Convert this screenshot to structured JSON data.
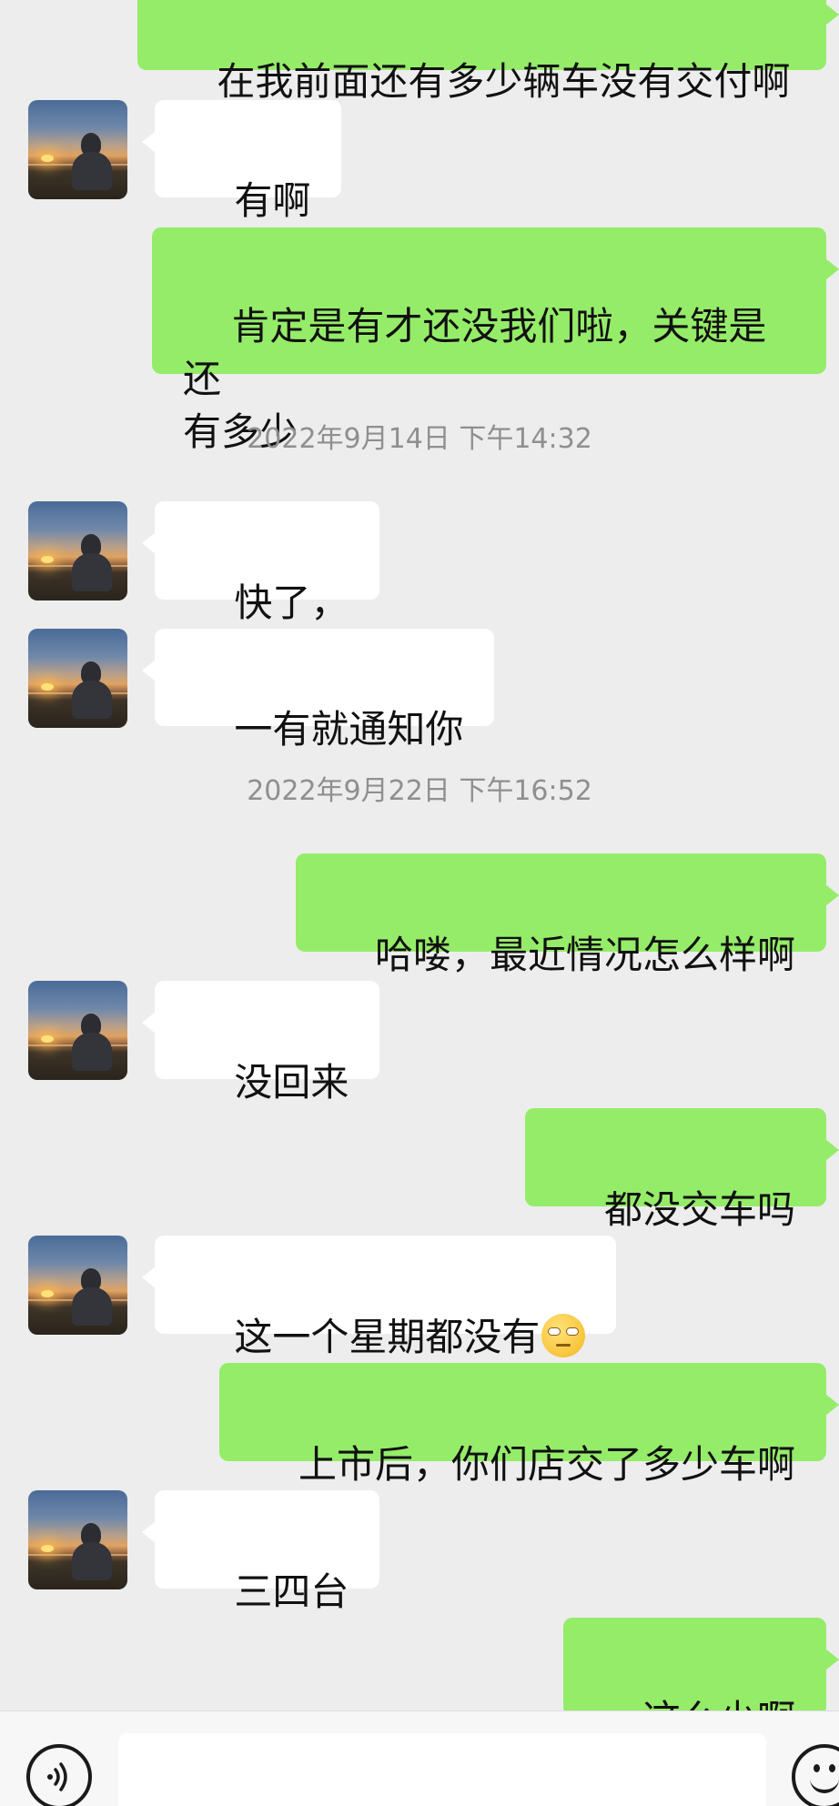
{
  "chat": {
    "messages": [
      {
        "sender": "self",
        "text": "在我前面还有多少辆车没有交付啊"
      },
      {
        "sender": "other",
        "text": "有啊"
      },
      {
        "sender": "self",
        "text": "肯定是有才还没我们啦，关键是还\n有多少"
      },
      {
        "type": "time",
        "text": "2022年9月14日 下午14:32"
      },
      {
        "sender": "other",
        "text": "快了，"
      },
      {
        "sender": "other",
        "text": "一有就通知你"
      },
      {
        "type": "time",
        "text": "2022年9月22日 下午16:52"
      },
      {
        "sender": "self",
        "text": "哈喽，最近情况怎么样啊"
      },
      {
        "sender": "other",
        "text": "没回来"
      },
      {
        "sender": "self",
        "text": "都没交车吗"
      },
      {
        "sender": "other",
        "text": "这一个星期都没有",
        "emoji": "eye-roll-emoji"
      },
      {
        "sender": "self",
        "text": "上市后，你们店交了多少车啊"
      },
      {
        "sender": "other",
        "text": "三四台"
      },
      {
        "sender": "self",
        "text": "这么少啊"
      }
    ]
  },
  "input_bar": {
    "voice_icon": "voice-icon",
    "emoji_icon": "emoji-icon",
    "text_value": ""
  },
  "colors": {
    "background": "#ededed",
    "self_bubble": "#95ec69",
    "other_bubble": "#ffffff",
    "timestamp": "#8f8f8f"
  }
}
